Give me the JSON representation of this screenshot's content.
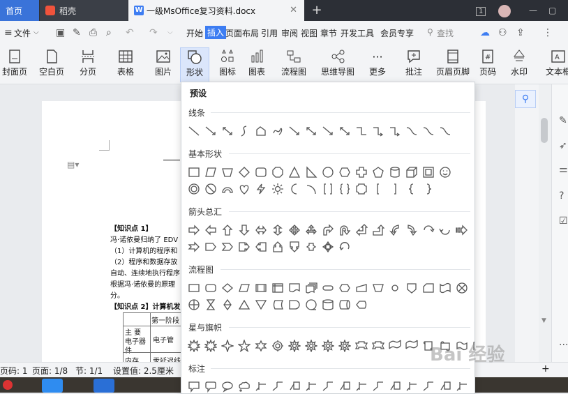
{
  "tabs": {
    "home": "首页",
    "daoke": "稻壳",
    "doc": "一级MsOffice复习资料.docx",
    "plus": "+"
  },
  "window": {
    "badge": "1"
  },
  "menu": {
    "file": "文件",
    "items": [
      "开始",
      "插入",
      "页面布局",
      "引用",
      "审阅",
      "视图",
      "章节",
      "开发工具",
      "会员专享"
    ],
    "search": "查找"
  },
  "toolbar": {
    "items": [
      "封面页",
      "空白页",
      "分页",
      "表格",
      "图片",
      "形状",
      "图标",
      "图表",
      "流程图",
      "思维导图",
      "更多",
      "批注",
      "页眉页脚",
      "页码",
      "水印",
      "文本框"
    ]
  },
  "panel": {
    "preset": "预设",
    "sections": [
      "线条",
      "基本形状",
      "箭头总汇",
      "流程图",
      "星与旗帜",
      "标注"
    ]
  },
  "document": {
    "lines": [
      "【知识点 1】",
      "冯·诺依曼归纳了 EDV",
      "（1）计算机的程序和",
      "（2）程序和数据存放",
      "自动、连续地执行程序",
      "根据冯·诺依曼的原理",
      "分。",
      "【知识点 2】计算机发"
    ],
    "table": {
      "header": "第一阶段",
      "row1_label": "主 要 电子器件",
      "row1_value": "电子管",
      "row2_label": "内存",
      "row2_value": "汞延迟线"
    }
  },
  "status": {
    "page_code": "页码: 1",
    "pages": "页面: 1/8",
    "section": "节: 1/1",
    "setting": "设置值: 2.5厘米",
    "plus": "+"
  },
  "watermark": "Bai 经验",
  "colors": {
    "accent": "#3d7df2",
    "tab_home": "#3a73d9"
  }
}
